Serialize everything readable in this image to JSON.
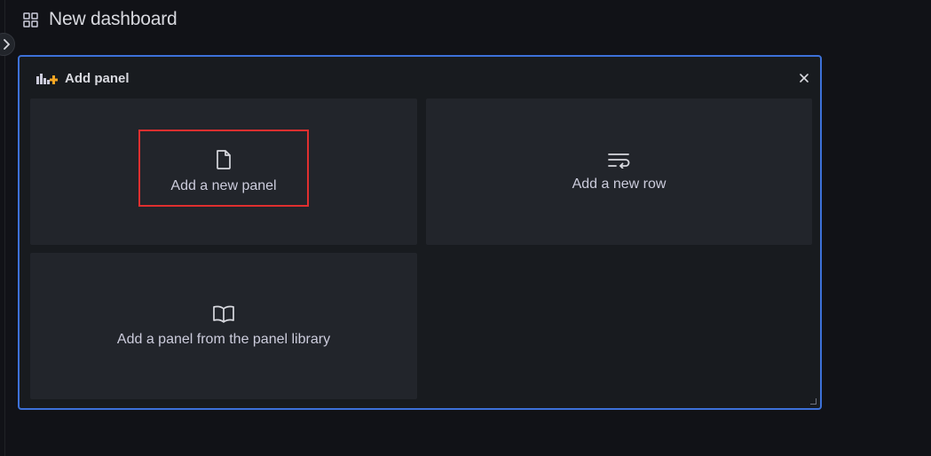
{
  "header": {
    "title": "New dashboard",
    "icon": "dashboard-grid-icon"
  },
  "sidebar": {
    "toggle_icon": "chevron-right-icon"
  },
  "panel": {
    "title": "Add panel",
    "title_icon": "add-panel-icon",
    "close_icon": "close-icon",
    "accent_color": "#3d71d9",
    "options": [
      {
        "label": "Add a new panel",
        "icon": "file-icon"
      },
      {
        "label": "Add a new row",
        "icon": "row-wrap-icon"
      },
      {
        "label": "Add a panel from the panel library",
        "icon": "book-open-icon"
      }
    ]
  },
  "colors": {
    "background": "#111217",
    "panel_bg": "#181b1f",
    "option_bg": "#22252b",
    "highlight": "#e02f2f",
    "add_icon_orange": "#f5a623"
  }
}
